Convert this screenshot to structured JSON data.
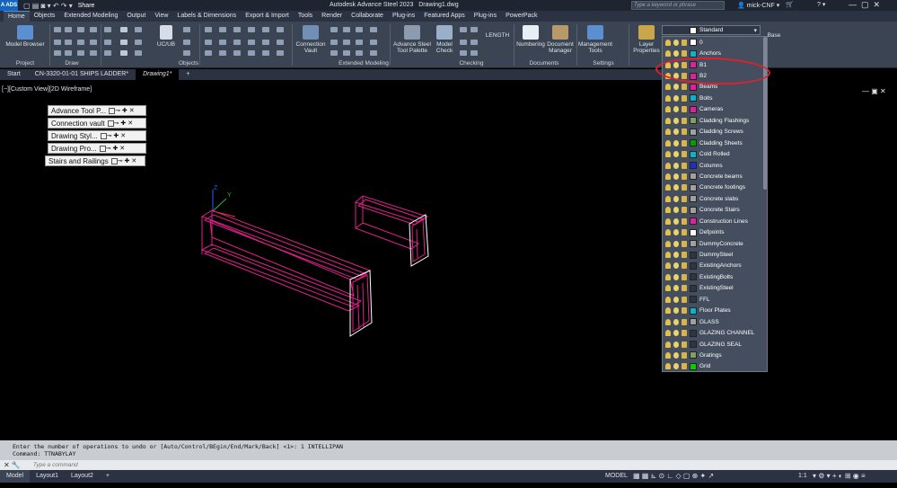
{
  "app": {
    "title": "Autodesk Advance Steel 2023",
    "file": "Drawing1.dwg",
    "badge": "A ADS",
    "share": "Share"
  },
  "search": {
    "placeholder": "Type a keyword or phrase"
  },
  "user": {
    "name": "mick-CNF"
  },
  "ribbon_tabs": [
    "Home",
    "Objects",
    "Extended Modeling",
    "Output",
    "View",
    "Labels & Dimensions",
    "Export & Import",
    "Tools",
    "Render",
    "Collaborate",
    "Plug-ins",
    "Featured Apps",
    "Plug-ins",
    "PowerPack"
  ],
  "ribbon": {
    "model_browser": "Model Browser",
    "ucs": "UC/UB",
    "connection_vault": "Connection Vault",
    "advance_steel_palette": "Advance Steel Tool Palette",
    "model_check": "Model Check",
    "length": "LENGTH",
    "numbering": "Numbering",
    "document_manager": "Document Manager",
    "management_tools": "Management Tools",
    "layer_properties": "Layer Properties",
    "base": "Base",
    "groups": {
      "project": "Project",
      "draw": "Draw",
      "objects": "Objects",
      "extended_modeling": "Extended Modeling",
      "checking": "Checking",
      "documents": "Documents",
      "settings": "Settings"
    }
  },
  "file_tabs": [
    "Start",
    "CN-3320-01-01 SHIPS LADDER*",
    "Drawing1*"
  ],
  "viewport": {
    "label": "[−][Custom View][2D Wireframe]"
  },
  "palettes": [
    "Advance Tool P...",
    "Connection vault",
    "Drawing Styl...",
    "Drawing Pro...",
    "Stairs and Railings"
  ],
  "layer_current": "Standard",
  "layers": [
    {
      "name": "0",
      "color": "#ffffff"
    },
    {
      "name": "Anchors",
      "color": "#00b7d0"
    },
    {
      "name": "B1",
      "color": "#e020a0"
    },
    {
      "name": "B2",
      "color": "#e020a0"
    },
    {
      "name": "Beams",
      "color": "#e020a0"
    },
    {
      "name": "Bolts",
      "color": "#00b7d0"
    },
    {
      "name": "Cameras",
      "color": "#e020a0"
    },
    {
      "name": "Cladding Flashings",
      "color": "#7fa060"
    },
    {
      "name": "Cladding Screws",
      "color": "#a0a0a0"
    },
    {
      "name": "Cladding Sheets",
      "color": "#00a000"
    },
    {
      "name": "Cold Rolled",
      "color": "#00b7d0"
    },
    {
      "name": "Columns",
      "color": "#1a2fd0"
    },
    {
      "name": "Concrete beams",
      "color": "#a0a0a0"
    },
    {
      "name": "Concrete footings",
      "color": "#a0a0a0"
    },
    {
      "name": "Concrete slabs",
      "color": "#a0a0a0"
    },
    {
      "name": "Concrete Stairs",
      "color": "#a0a0a0"
    },
    {
      "name": "Construction Lines",
      "color": "#e020a0"
    },
    {
      "name": "Defpoints",
      "color": "#ffffff"
    },
    {
      "name": "DummyConcrete",
      "color": "#a0a0a0"
    },
    {
      "name": "DummySteel",
      "color": "#2e3644"
    },
    {
      "name": "ExistingAnchors",
      "color": "#2e3644"
    },
    {
      "name": "ExistingBolts",
      "color": "#2e3644"
    },
    {
      "name": "ExistingSteel",
      "color": "#2e3644"
    },
    {
      "name": "FFL",
      "color": "#2e3644"
    },
    {
      "name": "Floor Plates",
      "color": "#00b7d0"
    },
    {
      "name": "GLASS",
      "color": "#a0a0a0"
    },
    {
      "name": "GLAZING CHANNEL",
      "color": "#2e3644"
    },
    {
      "name": "GLAZING SEAL",
      "color": "#2e3644"
    },
    {
      "name": "Gratings",
      "color": "#7fa060"
    },
    {
      "name": "Grid",
      "color": "#00d000"
    }
  ],
  "command": {
    "history1": "Enter the number of operations to undo or [Auto/Control/BEgin/End/Mark/Back] <1>: 1 INTELLIPAN",
    "history2": "Command: TTNABYLAY",
    "placeholder": "Type a command"
  },
  "layout_tabs": [
    "Model",
    "Layout1",
    "Layout2"
  ],
  "status": {
    "model": "MODEL",
    "scale": "1:1"
  }
}
